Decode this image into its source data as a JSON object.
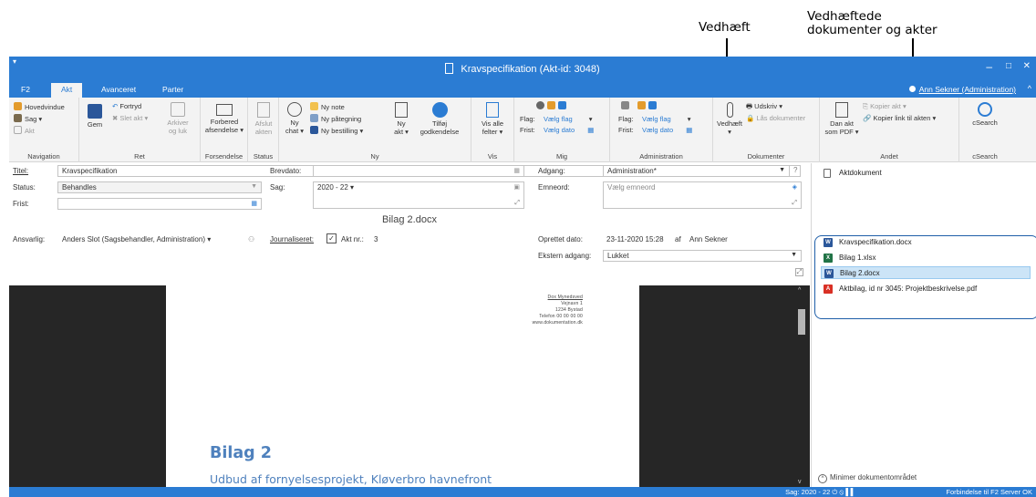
{
  "annotations": {
    "attach_label": "Vedhæft",
    "attached_label_line1": "Vedhæftede",
    "attached_label_line2": "dokumenter og akter"
  },
  "window": {
    "title": "Kravspecifikation (Akt-id: 3048)",
    "min": "–",
    "max": "□",
    "close": "✕"
  },
  "tabs": [
    {
      "label": "F2"
    },
    {
      "label": "Akt"
    },
    {
      "label": "Avanceret"
    },
    {
      "label": "Parter"
    }
  ],
  "user": "Ann Sekner (Administration)",
  "collapse": "^",
  "ribbon": {
    "navigation": {
      "label": "Navigation",
      "hovedvindue": "Hovedvindue",
      "sag": "Sag ▾",
      "akt": "Akt"
    },
    "ret": {
      "label": "Ret",
      "gem": "Gem",
      "fortryd": "Fortryd",
      "slet": "Slet akt ▾",
      "arkiver1": "Arkiver",
      "arkiver2": "og luk"
    },
    "forsendelse": {
      "label": "Forsendelse",
      "forbered1": "Forbered",
      "forbered2": "afsendelse ▾"
    },
    "status": {
      "label": "Status",
      "afslut1": "Afslut",
      "afslut2": "akten"
    },
    "ny": {
      "label": "Ny",
      "nychat1": "Ny",
      "nychat2": "chat ▾",
      "note": "Ny note",
      "paategning": "Ny påtegning",
      "bestilling": "Ny bestilling ▾",
      "nyakt1": "Ny",
      "nyakt2": "akt ▾",
      "tilfoj1": "Tilføj",
      "tilfoj2": "godkendelse"
    },
    "vis": {
      "label": "Vis",
      "visalle1": "Vis alle",
      "visalle2": "felter ▾"
    },
    "mig": {
      "label": "Mig",
      "flag": "Flag:",
      "flag_val": "Vælg flag",
      "frist": "Frist:",
      "frist_val": "Vælg dato"
    },
    "administration": {
      "label": "Administration",
      "flag": "Flag:",
      "flag_val": "Vælg flag",
      "frist": "Frist:",
      "frist_val": "Vælg dato"
    },
    "dokumenter": {
      "label": "Dokumenter",
      "vedhaeft": "Vedhæft",
      "udskriv": "Udskriv ▾",
      "laas": "Lås dokumenter"
    },
    "andet": {
      "label": "Andet",
      "danakt1": "Dan akt",
      "danakt2": "som PDF ▾",
      "kopier": "Kopier akt ▾",
      "kopierlink": "Kopier link til akten ▾"
    },
    "csearch": {
      "label": "cSearch",
      "btn": "cSearch"
    }
  },
  "form": {
    "titel_label": "Titel:",
    "titel_value": "Kravspecifikation",
    "status_label": "Status:",
    "status_value": "Behandles",
    "frist_label": "Frist:",
    "frist_value": "",
    "ansvarlig_label": "Ansvarlig:",
    "ansvarlig_value": "Anders Slot (Sagsbehandler, Administration) ▾",
    "brevdato_label": "Brevdato:",
    "brevdato_value": "",
    "sag_label": "Sag:",
    "sag_value": "2020 - 22 ▾",
    "journaliseret_label": "Journaliseret:",
    "akt_nr_label": "Akt nr.:",
    "akt_nr_value": "3",
    "adgang_label": "Adgang:",
    "adgang_value": "Administration*",
    "emneord_label": "Emneord:",
    "emneord_placeholder": "Vælg emneord",
    "oprettet_label": "Oprettet dato:",
    "oprettet_value": "23-11-2020 15:28",
    "oprettet_af": "af",
    "oprettet_by": "Ann Sekner",
    "ekstern_label": "Ekstern adgang:",
    "ekstern_value": "Lukket"
  },
  "document": {
    "filename": "Bilag 2.docx",
    "address": [
      "Dox Mynedsved",
      "Vejnavn 1",
      "1234 Bystad",
      "Telefon 00 00 00 00",
      "www.dokumentation.dk"
    ],
    "heading": "Bilag 2",
    "subheading": "Udbud af fornyelsesprojekt, Kløverbro havnefront"
  },
  "right_pane": {
    "items": [
      {
        "label": "Aktdokument",
        "icon": "document-icon"
      },
      {
        "label": "Kravspecifikation.docx",
        "icon": "word-icon"
      },
      {
        "label": "Bilag 1.xlsx",
        "icon": "excel-icon"
      },
      {
        "label": "Bilag 2.docx",
        "icon": "word-icon",
        "selected": true
      },
      {
        "label": "Aktbilag, id nr 3045: Projektbeskrivelse.pdf",
        "icon": "pdf-icon"
      }
    ],
    "minimize": "Minimer dokumentområdet"
  },
  "statusbar": {
    "sag": "Sag: 2020 - 22 ⏻ ⦸ ▌▌",
    "connection": "Forbindelse til F2 Server OK"
  },
  "colors": {
    "accent": "#2b7cd3",
    "heading_blue": "#4f81bd",
    "callout": "#1f5fa8",
    "word": "#2b579a",
    "excel": "#217346",
    "pdf": "#d93025"
  }
}
